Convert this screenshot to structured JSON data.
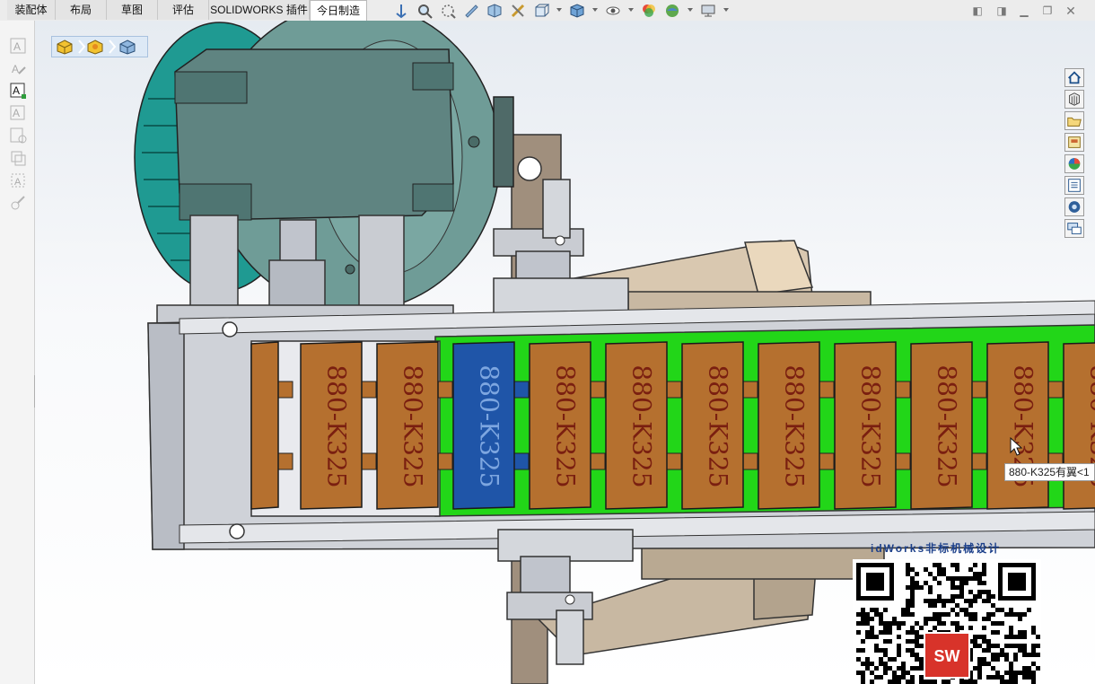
{
  "command_manager": {
    "tabs": [
      {
        "label": "装配体",
        "active": false
      },
      {
        "label": "布局",
        "active": false
      },
      {
        "label": "草图",
        "active": false
      },
      {
        "label": "评估",
        "active": false
      },
      {
        "label": "SOLIDWORKS 插件",
        "active": false
      },
      {
        "label": "今日制造",
        "active": true
      }
    ]
  },
  "heads_up_toolbar": {
    "icons": [
      "view-orientation-icon",
      "zoom-to-fit-icon",
      "zoom-to-area-icon",
      "previous-view-icon",
      "section-view-icon",
      "dynamic-annotation-icon",
      "view-orientation-dropdown-icon",
      "display-style-icon",
      "hide-show-items-icon",
      "edit-appearance-icon",
      "apply-scene-icon",
      "view-settings-icon"
    ]
  },
  "window_controls": [
    "restore-pane-icon",
    "tile-pane-icon",
    "minimize-icon",
    "restore-icon",
    "close-icon"
  ],
  "left_panel": {
    "icons": [
      "sketch-text-icon",
      "smart-dimension-icon",
      "note-icon",
      "balloon-icon",
      "auto-balloon-icon",
      "surface-finish-icon",
      "weld-symbol-icon",
      "hole-callout-icon"
    ]
  },
  "breadcrumb": {
    "items": [
      "assembly-icon",
      "component-icon",
      "part-icon"
    ]
  },
  "view_toolbar": {
    "icons": [
      "home-icon",
      "3d-view-icon",
      "open-icon",
      "design-library-icon",
      "appearances-icon",
      "custom-properties-icon",
      "solidworks-resources-icon",
      "forum-icon"
    ]
  },
  "chain_links": {
    "label": "880-K325",
    "count_visible": 12,
    "selected_index": 3
  },
  "tooltip": {
    "text": "880-K325有翼<1"
  },
  "watermark": {
    "title": "idWorks非标机械设计",
    "logo_letters": "SW"
  },
  "colors": {
    "link_orange": "#b5702f",
    "link_selected": "#1f55a8",
    "belt_green": "#22d618",
    "motor_teal": "#2c9f97",
    "frame_gray": "#c9ccd2"
  }
}
